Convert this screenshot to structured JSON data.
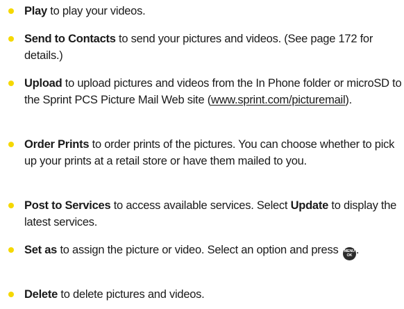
{
  "items": [
    {
      "term": "Play",
      "text": " to play your videos."
    },
    {
      "term": "Send to Contacts",
      "text": " to send your pictures and videos. (See page 172 for details.)"
    },
    {
      "term": "Upload",
      "text": " to upload pictures and videos from the In Phone folder or microSD to the Sprint PCS Picture Mail Web site (",
      "link": "www.sprint.com/picturemail",
      "after": ")."
    },
    {
      "term": "Order Prints",
      "text": " to order prints of the pictures. You can choose whether to pick up your prints at a retail store or have them mailed to you."
    },
    {
      "term": "Post to Services",
      "text": " to access available services. Select ",
      "term2": "Update",
      "after": " to display the latest services."
    },
    {
      "term": "Set as",
      "text": " to assign the picture or video. Select an option and press ",
      "key_top": "MENU",
      "key_bottom": "OK",
      "after": "."
    },
    {
      "term": "Delete",
      "text": " to delete pictures and videos."
    }
  ],
  "colors": {
    "bullet": "#f5d800",
    "text": "#1a1a1a",
    "menu_key": "#2b2b2b"
  },
  "icons": {
    "menu_key": "menu-ok-key-icon"
  }
}
